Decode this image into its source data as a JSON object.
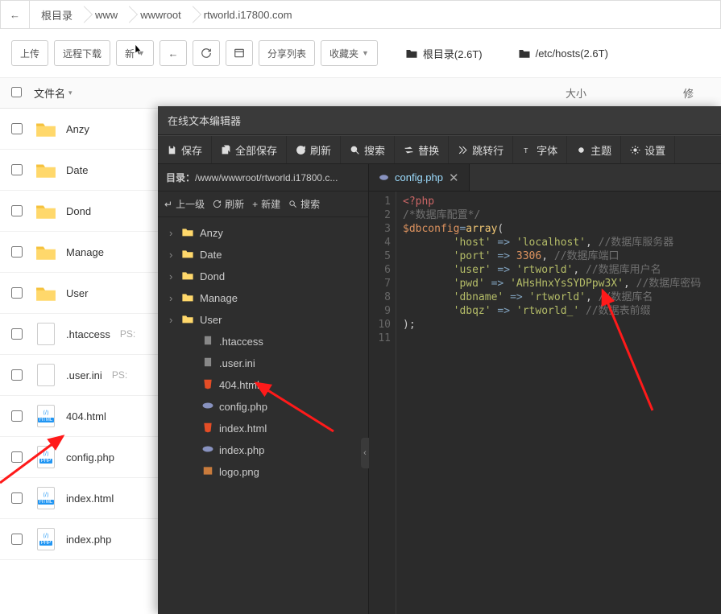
{
  "breadcrumb": {
    "items": [
      "根目录",
      "www",
      "wwwroot",
      "rtworld.i17800.com"
    ]
  },
  "toolbar": {
    "upload": "上传",
    "remote": "远程下载",
    "new": "新",
    "share": "分享列表",
    "fav": "收藏夹",
    "root_link": "根目录(2.6T)",
    "hosts_link": "/etc/hosts(2.6T)"
  },
  "table": {
    "name_col": "文件名",
    "size_col": "大小",
    "mod_col": "修"
  },
  "files": [
    {
      "name": "Anzy",
      "type": "folder"
    },
    {
      "name": "Date",
      "type": "folder"
    },
    {
      "name": "Dond",
      "type": "folder"
    },
    {
      "name": "Manage",
      "type": "folder"
    },
    {
      "name": "User",
      "type": "folder"
    },
    {
      "name": ".htaccess",
      "type": "file",
      "note": "PS:"
    },
    {
      "name": ".user.ini",
      "type": "file",
      "note": "PS:"
    },
    {
      "name": "404.html",
      "type": "html"
    },
    {
      "name": "config.php",
      "type": "php"
    },
    {
      "name": "index.html",
      "type": "html"
    },
    {
      "name": "index.php",
      "type": "php"
    }
  ],
  "editor": {
    "title": "在线文本编辑器",
    "menu": {
      "save": "保存",
      "save_all": "全部保存",
      "refresh": "刷新",
      "search": "搜索",
      "replace": "替换",
      "goto": "跳转行",
      "font": "字体",
      "theme": "主题",
      "settings": "设置"
    },
    "path_label": "目录：",
    "path_value": "/www/wwwroot/rtworld.i17800.c...",
    "side_tools": {
      "up": "上一级",
      "refresh": "刷新",
      "new": "新建",
      "search": "搜索"
    },
    "tree": [
      {
        "name": "Anzy",
        "kind": "folder",
        "level": 0
      },
      {
        "name": "Date",
        "kind": "folder",
        "level": 0
      },
      {
        "name": "Dond",
        "kind": "folder",
        "level": 0
      },
      {
        "name": "Manage",
        "kind": "folder",
        "level": 0
      },
      {
        "name": "User",
        "kind": "folder",
        "level": 0
      },
      {
        "name": ".htaccess",
        "kind": "file",
        "level": 1
      },
      {
        "name": ".user.ini",
        "kind": "file",
        "level": 1
      },
      {
        "name": "404.html",
        "kind": "html",
        "level": 1
      },
      {
        "name": "config.php",
        "kind": "php",
        "level": 1
      },
      {
        "name": "index.html",
        "kind": "html",
        "level": 1
      },
      {
        "name": "index.php",
        "kind": "php",
        "level": 1
      },
      {
        "name": "logo.png",
        "kind": "img",
        "level": 1
      }
    ],
    "tab": "config.php",
    "code": {
      "lines": [
        "1",
        "2",
        "3",
        "4",
        "5",
        "6",
        "7",
        "8",
        "9",
        "10",
        "11"
      ],
      "content": {
        "l1_open": "<?php",
        "l2_cmt": "/*数据库配置*/",
        "l3_var": "$dbconfig",
        "l3_eq": "=",
        "l3_fn": "array",
        "l3_paren": "(",
        "l4_k": "'host'",
        "l4_v": "'localhost'",
        "l4_cmt": "//数据库服务器",
        "l5_k": "'port'",
        "l5_v": "3306",
        "l5_cmt": "//数据库端口",
        "l6_k": "'user'",
        "l6_v": "'rtworld'",
        "l6_cmt": "//数据库用户名",
        "l7_k": "'pwd'",
        "l7_v": "'AHsHnxYsSYDPpw3X'",
        "l7_cmt": "//数据库密码",
        "l8_k": "'dbname'",
        "l8_v": "'rtworld'",
        "l8_cmt": "//数据库名",
        "l9_k": "'dbqz'",
        "l9_v": "'rtworld_'",
        "l9_cmt": "//数据表前缀",
        "l10_close": ");",
        "arrow_op": " => ",
        "comma": ","
      }
    }
  }
}
